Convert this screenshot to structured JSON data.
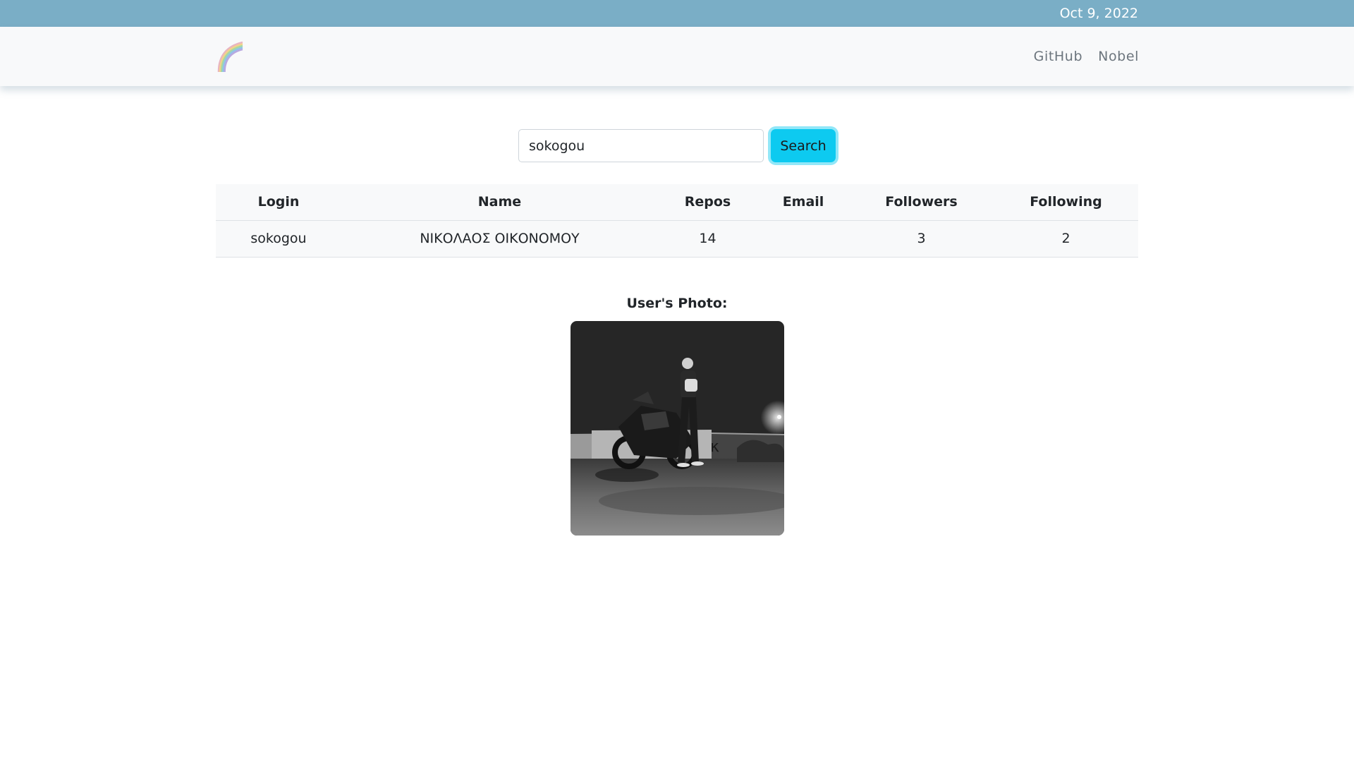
{
  "topbar": {
    "date": "Oct 9, 2022"
  },
  "nav": {
    "logo_icon": "rainbow-logo-icon",
    "links": [
      {
        "label": "GitHub"
      },
      {
        "label": "Nobel"
      }
    ]
  },
  "search": {
    "value": "sokogou",
    "button_label": "Search"
  },
  "table": {
    "headers": [
      "Login",
      "Name",
      "Repos",
      "Email",
      "Followers",
      "Following"
    ],
    "rows": [
      {
        "login": "sokogou",
        "name": "ΝΙΚΟΛΑΟΣ ΟΙΚΟΝΟΜΟΥ",
        "repos": "14",
        "email": "",
        "followers": "3",
        "following": "2"
      }
    ]
  },
  "photo": {
    "label": "User's Photo:",
    "icon": "user-photo-motorcycle"
  },
  "colors": {
    "topbar": "#7aaec6",
    "search_button": "#0dcaf0",
    "navbar": "#f8f9fa"
  }
}
